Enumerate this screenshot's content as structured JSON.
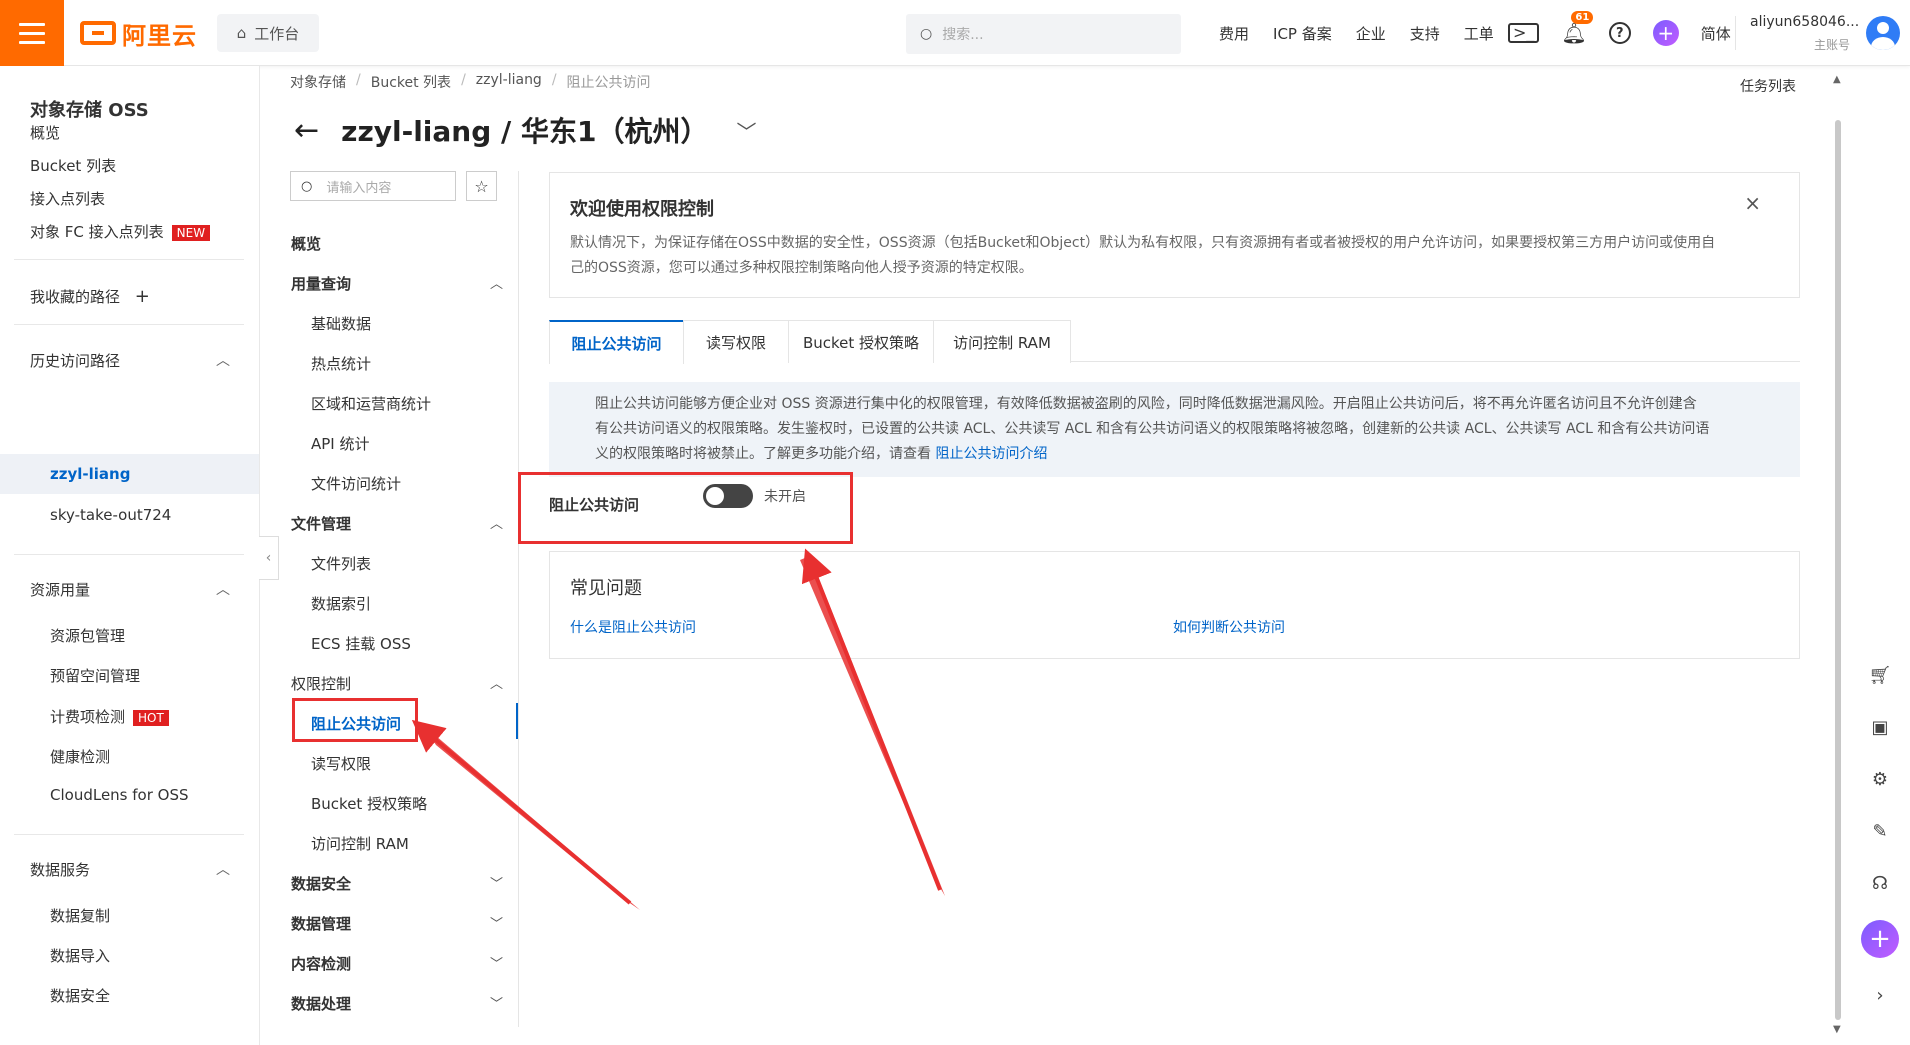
{
  "topbar": {
    "brand": "阿里云",
    "workbench": "工作台",
    "search_placeholder": "搜索...",
    "nav": [
      "费用",
      "ICP 备案",
      "企业",
      "支持",
      "工单"
    ],
    "notification_count": "61",
    "lang": "简体",
    "account_name": "aliyun658046...",
    "account_role": "主账号",
    "accent_color": "#ff6a00"
  },
  "sidebar": {
    "title": "对象存储 OSS",
    "items": [
      "概览",
      "Bucket 列表",
      "接入点列表",
      "对象 FC 接入点列表"
    ],
    "new_tag": "NEW",
    "favorites": "我收藏的路径",
    "history_title": "历史访问路径",
    "history": [
      "zzyl-liang",
      "sky-take-out724"
    ],
    "resource_title": "资源用量",
    "resource_items": [
      "资源包管理",
      "预留空间管理",
      "计费项检测",
      "健康检测",
      "CloudLens for OSS"
    ],
    "hot_tag": "HOT",
    "data_service_title": "数据服务",
    "data_service_items": [
      "数据复制",
      "数据导入",
      "数据安全"
    ]
  },
  "breadcrumb": [
    "对象存储",
    "Bucket 列表",
    "zzyl-liang",
    "阻止公共访问"
  ],
  "task_list": "任务列表",
  "page_title": "zzyl-liang / 华东1（杭州）",
  "secondary_menu": {
    "search_placeholder": "请输入内容",
    "overview": "概览",
    "usage_title": "用量查询",
    "usage_items": [
      "基础数据",
      "热点统计",
      "区域和运营商统计",
      "API 统计",
      "文件访问统计"
    ],
    "file_title": "文件管理",
    "file_items": [
      "文件列表",
      "数据索引",
      "ECS 挂载 OSS"
    ],
    "perm_title": "权限控制",
    "perm_items": [
      "阻止公共访问",
      "读写权限",
      "Bucket 授权策略",
      "访问控制 RAM"
    ],
    "collapsed": [
      "数据安全",
      "数据管理",
      "内容检测",
      "数据处理"
    ]
  },
  "welcome": {
    "title": "欢迎使用权限控制",
    "body_line1": "默认情况下，为保证存储在OSS中数据的安全性，OSS资源（包括Bucket和Object）默认为私有权限，只有资源拥有者或者被授权的用户允许访问，如果要授权第三方用户访问或使用自",
    "body_line2": "己的OSS资源，您可以通过多种权限控制策略向他人授予资源的特定权限。"
  },
  "tabs": [
    "阻止公共访问",
    "读写权限",
    "Bucket 授权策略",
    "访问控制 RAM"
  ],
  "info": {
    "line1": "阻止公共访问能够方便企业对 OSS 资源进行集中化的权限管理，有效降低数据被盗刷的风险，同时降低数据泄漏风险。开启阻止公共访问后，将不再允许匿名访问且不允许创建含",
    "line2": "有公共访问语义的权限策略。发生鉴权时，已设置的公共读 ACL、公共读写 ACL 和含有公共访问语义的权限策略将被忽略，创建新的公共读 ACL、公共读写 ACL 和含有公共访问语",
    "line3": "义的权限策略时将被禁止。了解更多功能介绍，请查看 ",
    "link": "阻止公共访问介绍"
  },
  "toggle": {
    "label": "阻止公共访问",
    "state_text": "未开启"
  },
  "faq": {
    "title": "常见问题",
    "q1": "什么是阻止公共访问",
    "q2": "如何判断公共访问"
  }
}
